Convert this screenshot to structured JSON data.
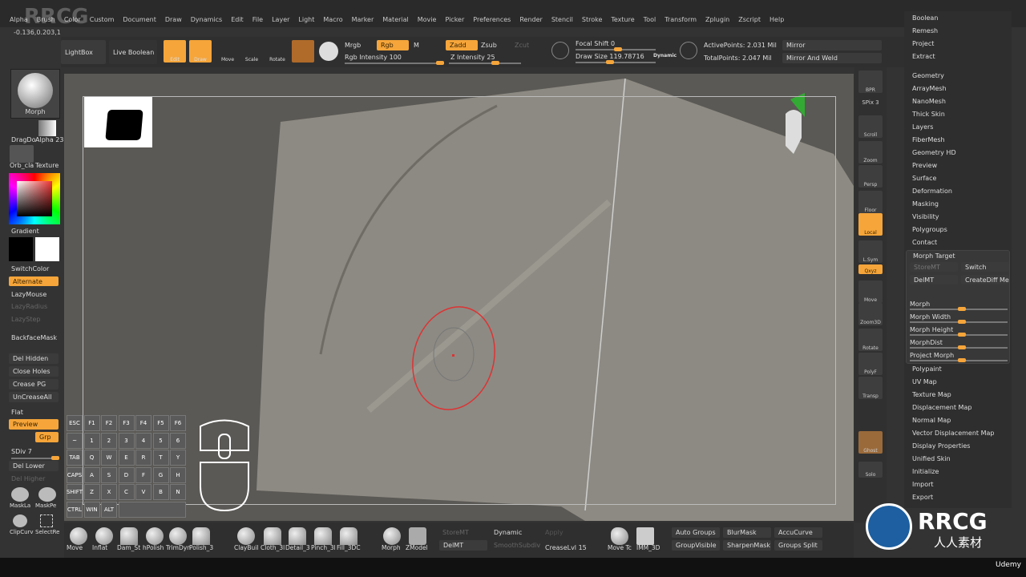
{
  "menu": [
    "Alpha",
    "Brush",
    "Color",
    "Custom",
    "Document",
    "Draw",
    "Dynamics",
    "Edit",
    "File",
    "Layer",
    "Light",
    "Macro",
    "Marker",
    "Material",
    "Movie",
    "Picker",
    "Preferences",
    "Render",
    "Stencil",
    "Stroke",
    "Texture",
    "Tool",
    "Transform",
    "Zplugin",
    "Zscript",
    "Help"
  ],
  "version": "-0.136,0.203,1",
  "toolbar": {
    "lightbox": "LightBox",
    "live_boolean": "Live Boolean",
    "edit": "Edit",
    "draw": "Draw",
    "move": "Move",
    "scale": "Scale",
    "rotate": "Rotate",
    "mrgb": "Mrgb",
    "rgb": "Rgb",
    "m": "M",
    "rgb_intensity": "Rgb Intensity 100",
    "zadd": "Zadd",
    "zsub": "Zsub",
    "zcut": "Zcut",
    "z_intensity": "Z Intensity 25",
    "focal_shift": "Focal Shift 0",
    "draw_size": "Draw Size 119.78716",
    "dynamic": "Dynamic",
    "active_points": "ActivePoints: 2.031 Mil",
    "total_points": "TotalPoints: 2.047 Mil",
    "mirror": "Mirror",
    "mirror_weld": "Mirror And Weld"
  },
  "left": {
    "material": "Morph",
    "stroke": "DragDo",
    "alpha": "Alpha 23",
    "texture_mat": "Orb_cla",
    "texture": "Texture",
    "gradient": "Gradient",
    "switch_color": "SwitchColor",
    "alternate": "Alternate",
    "lazymouse": "LazyMouse",
    "lazyradius": "LazyRadius",
    "lazystep": "LazyStep",
    "backface": "BackfaceMask",
    "del_hidden": "Del Hidden",
    "close_holes": "Close Holes",
    "crease_pg": "Crease PG",
    "uncrease": "UnCreaseAll",
    "flat": "Flat",
    "preview": "Preview",
    "grp": "Grp",
    "sdiv": "SDiv 7",
    "del_lower": "Del Lower",
    "del_higher": "Del Higher",
    "mask_lasso": "MaskLa",
    "mask_pen": "MaskPe",
    "clip": "ClipCurv",
    "select": "SelectRe"
  },
  "keyboard": [
    [
      "ESC",
      "F1",
      "F2",
      "F3",
      "F4",
      "F5",
      "F6"
    ],
    [
      "~",
      "1",
      "2",
      "3",
      "4",
      "5",
      "6"
    ],
    [
      "TAB",
      "Q",
      "W",
      "E",
      "R",
      "T",
      "Y"
    ],
    [
      "CAPS",
      "A",
      "S",
      "D",
      "F",
      "G",
      "H"
    ],
    [
      "SHIFT",
      "Z",
      "X",
      "C",
      "V",
      "B",
      "N"
    ],
    [
      "CTRL",
      "WIN",
      "ALT"
    ]
  ],
  "right_shelf": [
    "BPR",
    "SPix 3",
    "Scroll",
    "Zoom",
    "Persp",
    "Floor",
    "Local",
    "L.Sym",
    "Qxyz",
    "Move",
    "Zoom3D",
    "Rotate",
    "PolyF",
    "Transp",
    "Ghost",
    "Solo"
  ],
  "palette": {
    "top": [
      "Boolean",
      "Remesh",
      "Project",
      "Extract"
    ],
    "items": [
      "Geometry",
      "ArrayMesh",
      "NanoMesh",
      "Thick Skin",
      "Layers",
      "FiberMesh",
      "Geometry HD",
      "Preview",
      "Surface",
      "Deformation",
      "Masking",
      "Visibility",
      "Polygroups",
      "Contact"
    ],
    "after": [
      "Polypaint",
      "UV Map",
      "Texture Map",
      "Displacement Map",
      "Normal Map",
      "Vector Displacement Map",
      "Display Properties",
      "Unified Skin",
      "Initialize",
      "Import",
      "Export"
    ]
  },
  "morph_target": {
    "title": "Morph Target",
    "storemt": "StoreMT",
    "switch": "Switch",
    "delmt": "DelMT",
    "creatediff": "CreateDiff Mesh",
    "sliders": [
      "Morph",
      "Morph Width",
      "Morph Height",
      "MorphDist",
      "Project Morph"
    ]
  },
  "bottom": {
    "brushes": [
      "Move",
      "Inflat",
      "Dam_St",
      "hPolish",
      "TrimDyn",
      "Polish_3",
      "ClayBuil",
      "Cloth_3l",
      "Detail_3",
      "Pinch_3l",
      "Fill_3DC"
    ],
    "morph": "Morph",
    "zmodeler": "ZModel",
    "storemt": "StoreMT",
    "delmt": "DelMT",
    "dynamic": "Dynamic",
    "smooth": "SmoothSubdiv",
    "apply": "Apply",
    "crease": "CreaseLvl 15",
    "move_tool": "Move Tc",
    "imm": "IMM_3D",
    "auto_groups": "Auto Groups",
    "group_visible": "GroupVisible",
    "blur_mask": "BlurMask",
    "sharpen_mask": "SharpenMask",
    "accucurve": "AccuCurve",
    "groups_split": "Groups Split"
  },
  "watermark": {
    "logo": "RRCG",
    "sub": "人人素材",
    "udemy": "Udemy"
  },
  "colors": {
    "accent": "#f5a53a",
    "canvas": "#5b5955",
    "model": "#8d8a83"
  }
}
